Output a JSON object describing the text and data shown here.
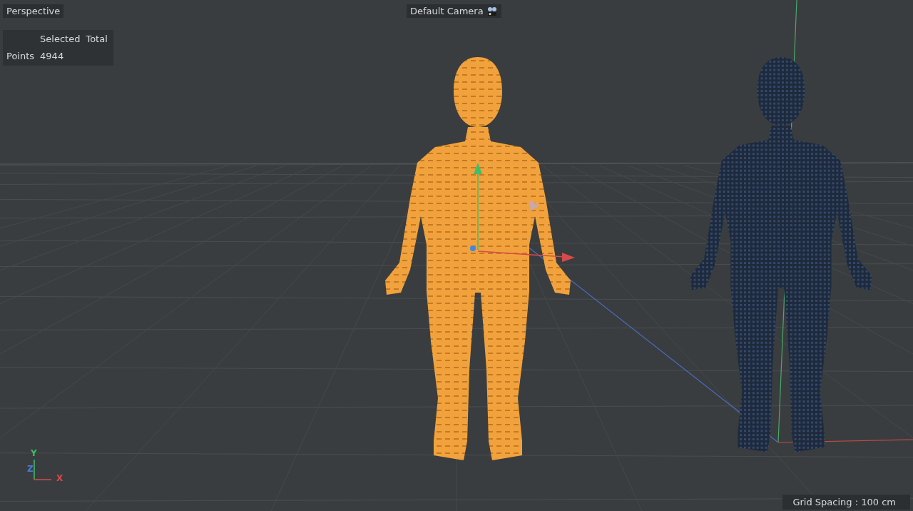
{
  "viewport": {
    "view_name": "Perspective",
    "camera": "Default Camera",
    "stats": {
      "columns": [
        "Selected",
        "Total"
      ],
      "rows": [
        {
          "label": "Points",
          "cells": [
            "4944",
            ""
          ]
        }
      ]
    },
    "axis_labels": [
      {
        "kind": "y",
        "text": "Y"
      },
      {
        "kind": "z",
        "text": "Z"
      },
      {
        "kind": "x",
        "text": "X"
      }
    ],
    "grid_spacing": "Grid Spacing : 100 cm"
  }
}
